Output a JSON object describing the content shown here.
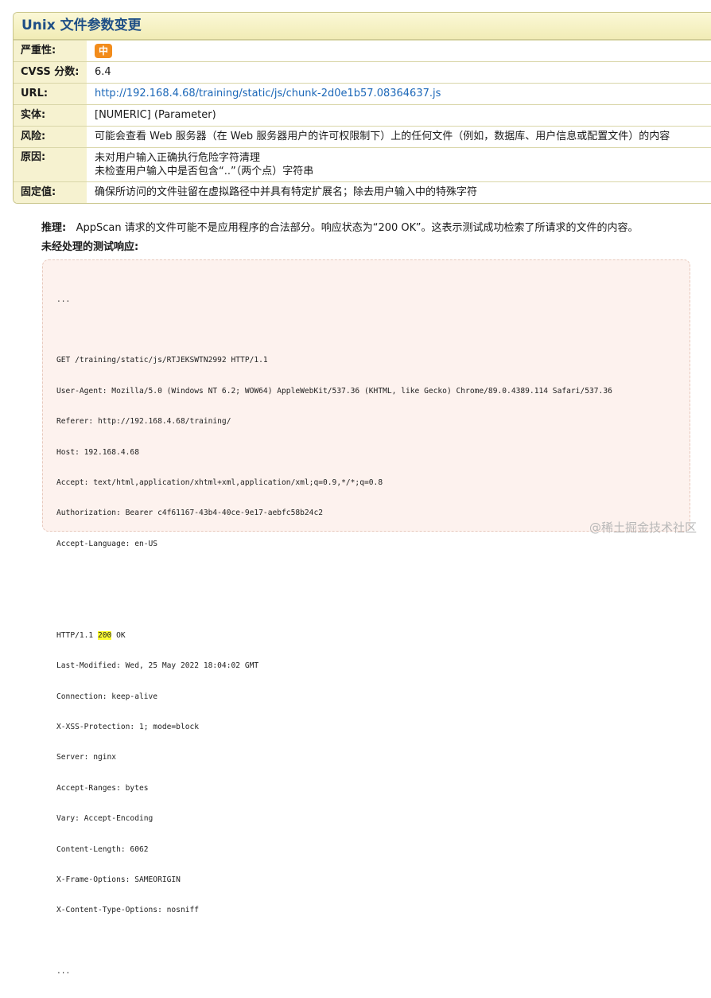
{
  "issue": {
    "title": "Unix 文件参数变更",
    "rows": {
      "severity": {
        "label": "严重性:",
        "value": "中"
      },
      "cvss": {
        "label": "CVSS 分数:",
        "value": "6.4"
      },
      "url": {
        "label": "URL:",
        "value": "http://192.168.4.68/training/static/js/chunk-2d0e1b57.08364637.js"
      },
      "entity": {
        "label": "实体:",
        "value": "[NUMERIC] (Parameter)"
      },
      "risk": {
        "label": "风险:",
        "value": "可能会查看 Web 服务器（在 Web 服务器用户的许可权限制下）上的任何文件（例如，数据库、用户信息或配置文件）的内容"
      },
      "cause": {
        "label": "原因:",
        "line1": "未对用户输入正确执行危险字符清理",
        "line2": "未检查用户输入中是否包含“..”（两个点）字符串"
      },
      "fix": {
        "label": "固定值:",
        "value": "确保所访问的文件驻留在虚拟路径中并具有特定扩展名；除去用户输入中的特殊字符"
      }
    },
    "severity_color": "#f28c1c"
  },
  "reasoning": {
    "label": "推理:",
    "text": "AppScan 请求的文件可能不是应用程序的合法部分。响应状态为“200 OK”。这表示测试成功检索了所请求的文件的内容。"
  },
  "raw_response": {
    "label": "未经处理的测试响应:",
    "request_lines": [
      "...",
      "",
      "GET /training/static/js/RTJEKSWTN2992 HTTP/1.1",
      "User-Agent: Mozilla/5.0 (Windows NT 6.2; WOW64) AppleWebKit/537.36 (KHTML, like Gecko) Chrome/89.0.4389.114 Safari/537.36",
      "Referer: http://192.168.4.68/training/",
      "Host: 192.168.4.68",
      "Accept: text/html,application/xhtml+xml,application/xml;q=0.9,*/*;q=0.8",
      "Authorization: Bearer c4f61167-43b4-40ce-9e17-aebfc58b24c2",
      "Accept-Language: en-US",
      "",
      ""
    ],
    "status_prefix": "HTTP/1.1 ",
    "status_code": "200",
    "status_suffix": " OK",
    "response_lines": [
      "Last-Modified: Wed, 25 May 2022 18:04:02 GMT",
      "Connection: keep-alive",
      "X-XSS-Protection: 1; mode=block",
      "Server: nginx",
      "Accept-Ranges: bytes",
      "Vary: Accept-Encoding",
      "Content-Length: 6062",
      "X-Frame-Options: SAMEORIGIN",
      "X-Content-Type-Options: nosniff",
      "",
      "..."
    ]
  },
  "watermark": "@稀土掘金技术社区"
}
